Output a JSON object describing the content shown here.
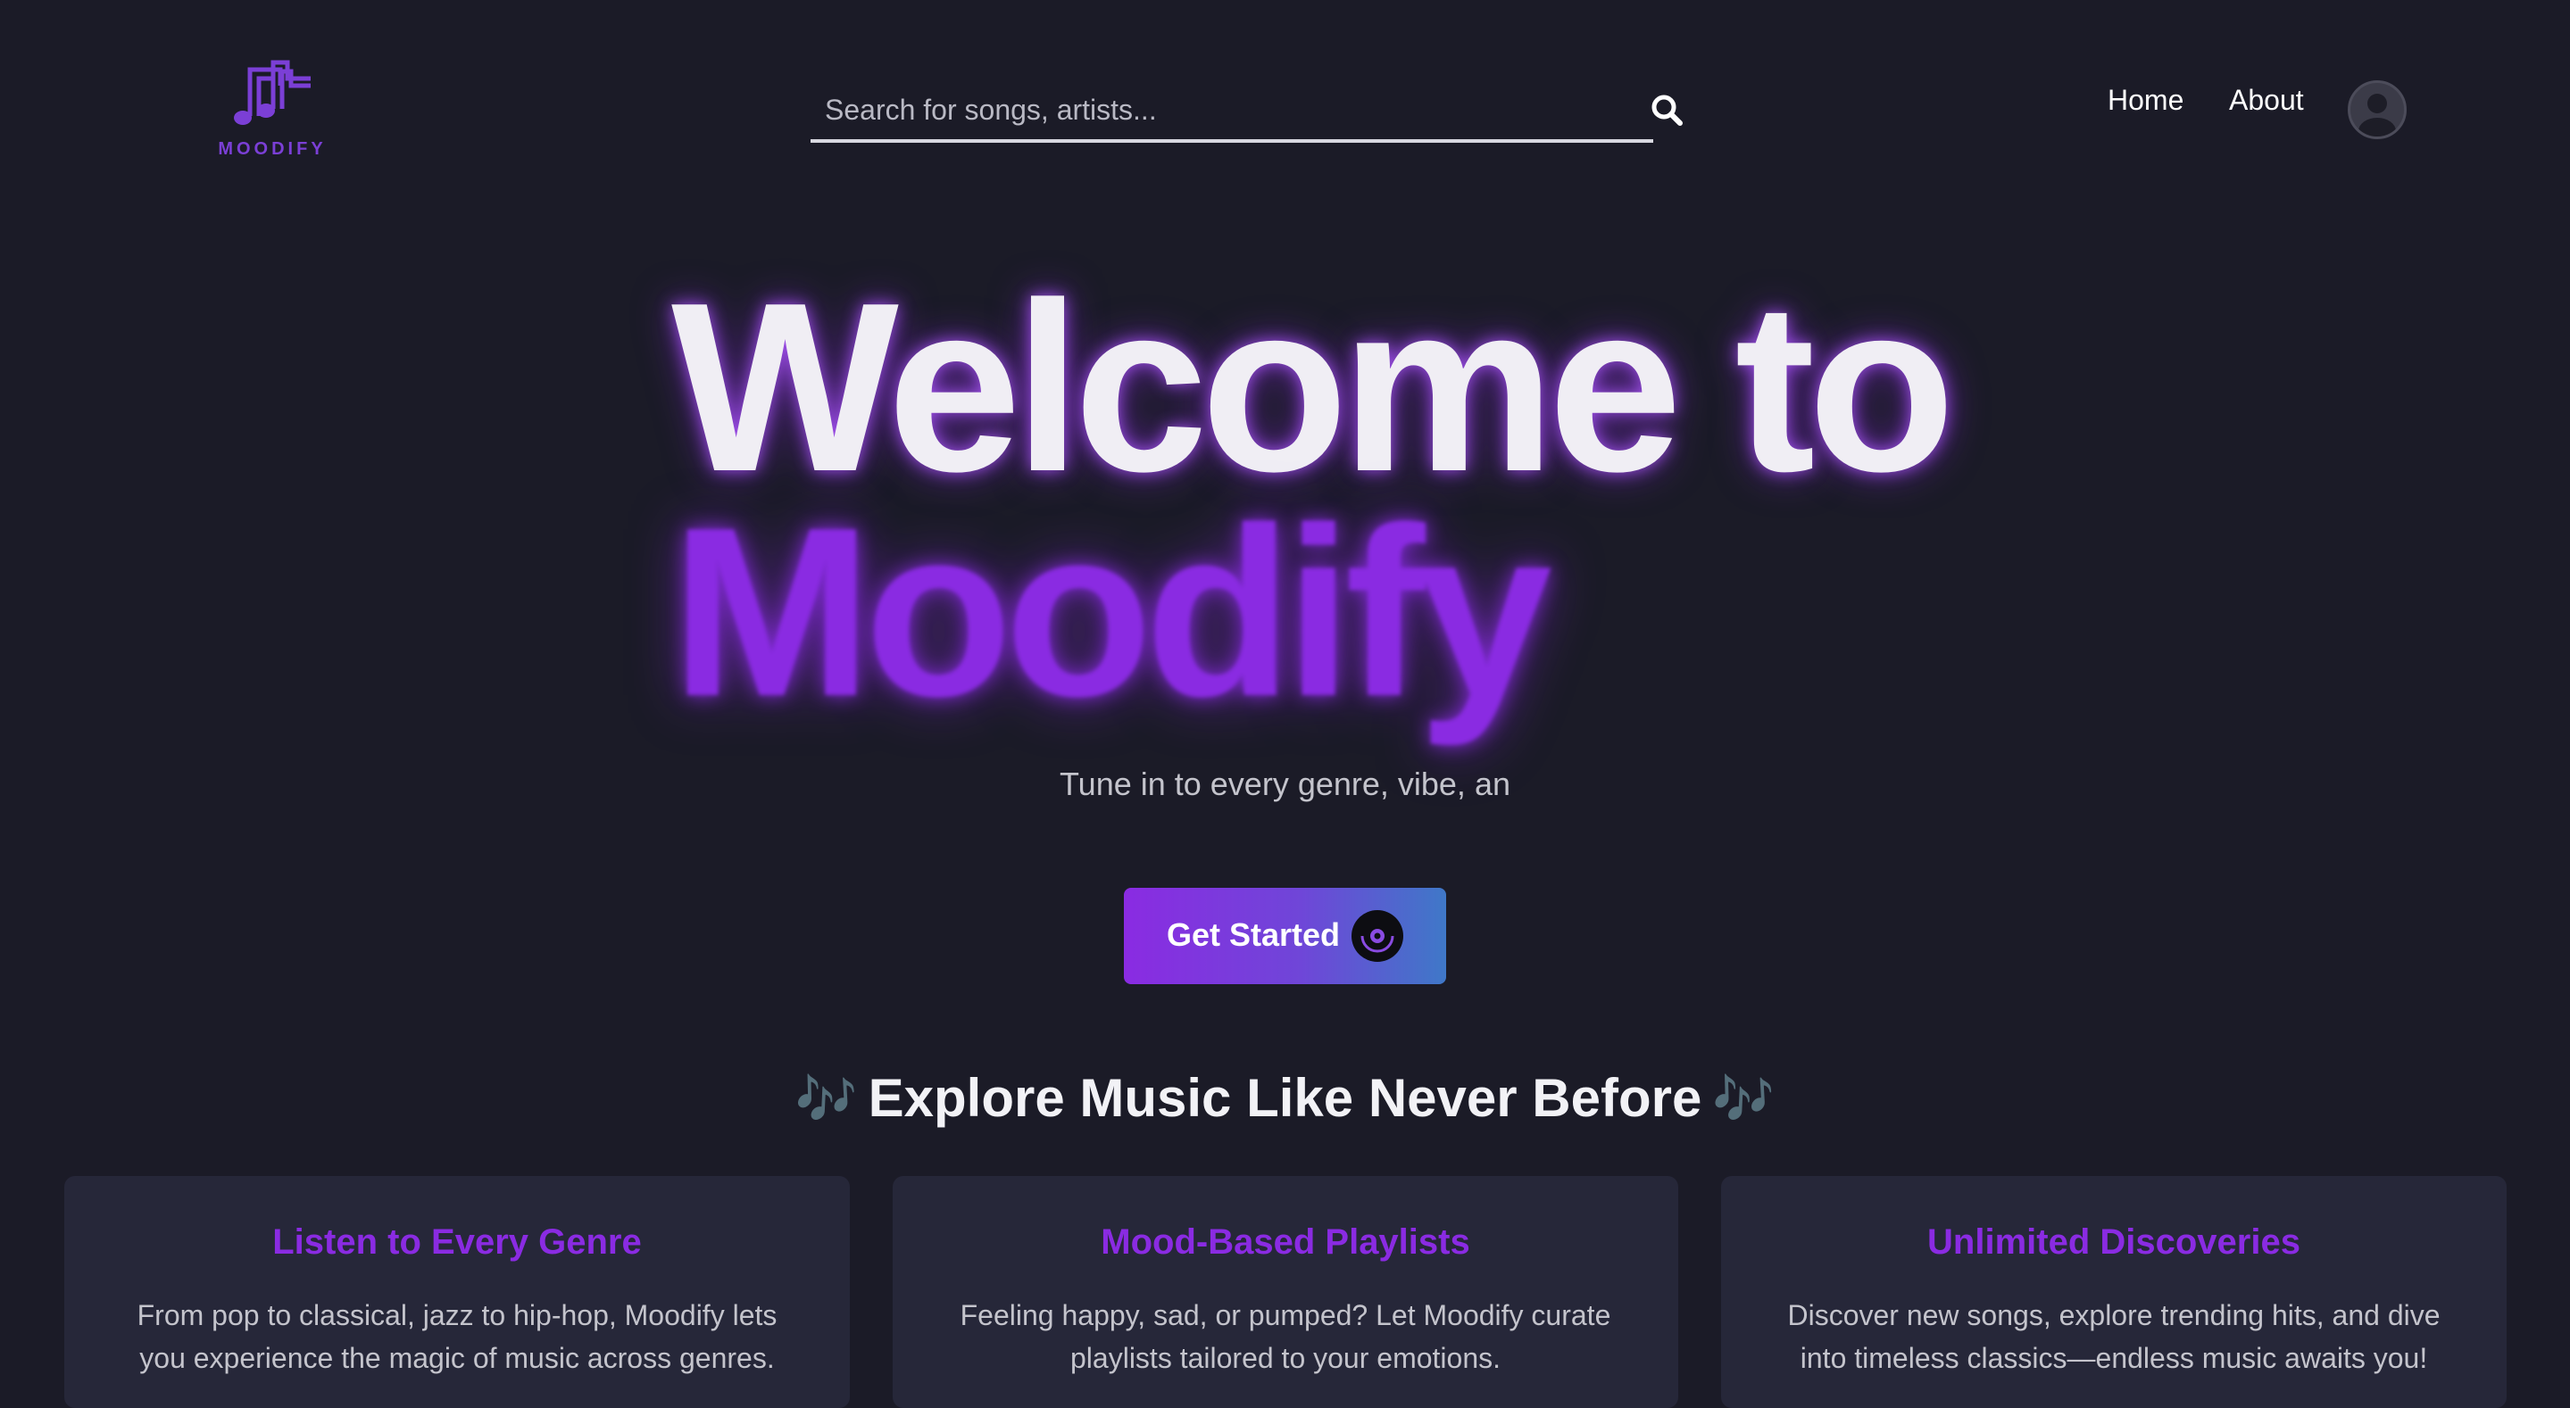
{
  "brand": {
    "name": "MOODIFY",
    "accent": "#8a2be2"
  },
  "search": {
    "placeholder": "Search for songs, artists...",
    "icon": "search-icon"
  },
  "nav": {
    "home": "Home",
    "about": "About"
  },
  "hero": {
    "line1": "Welcome to",
    "line2": "Moodify",
    "tagline": "Tune in to every genre, vibe, an"
  },
  "cta": {
    "label": "Get Started",
    "icon": "vinyl-disc-icon"
  },
  "section": {
    "notes": "🎶",
    "title": "Explore Music Like Never Before"
  },
  "features": [
    {
      "title": "Listen to Every Genre",
      "description": "From pop to classical, jazz to hip-hop, Moodify lets you experience the magic of music across genres."
    },
    {
      "title": "Mood-Based Playlists",
      "description": "Feeling happy, sad, or pumped? Let Moodify curate playlists tailored to your emotions."
    },
    {
      "title": "Unlimited Discoveries",
      "description": "Discover new songs, explore trending hits, and dive into timeless classics—endless music awaits you!"
    }
  ]
}
